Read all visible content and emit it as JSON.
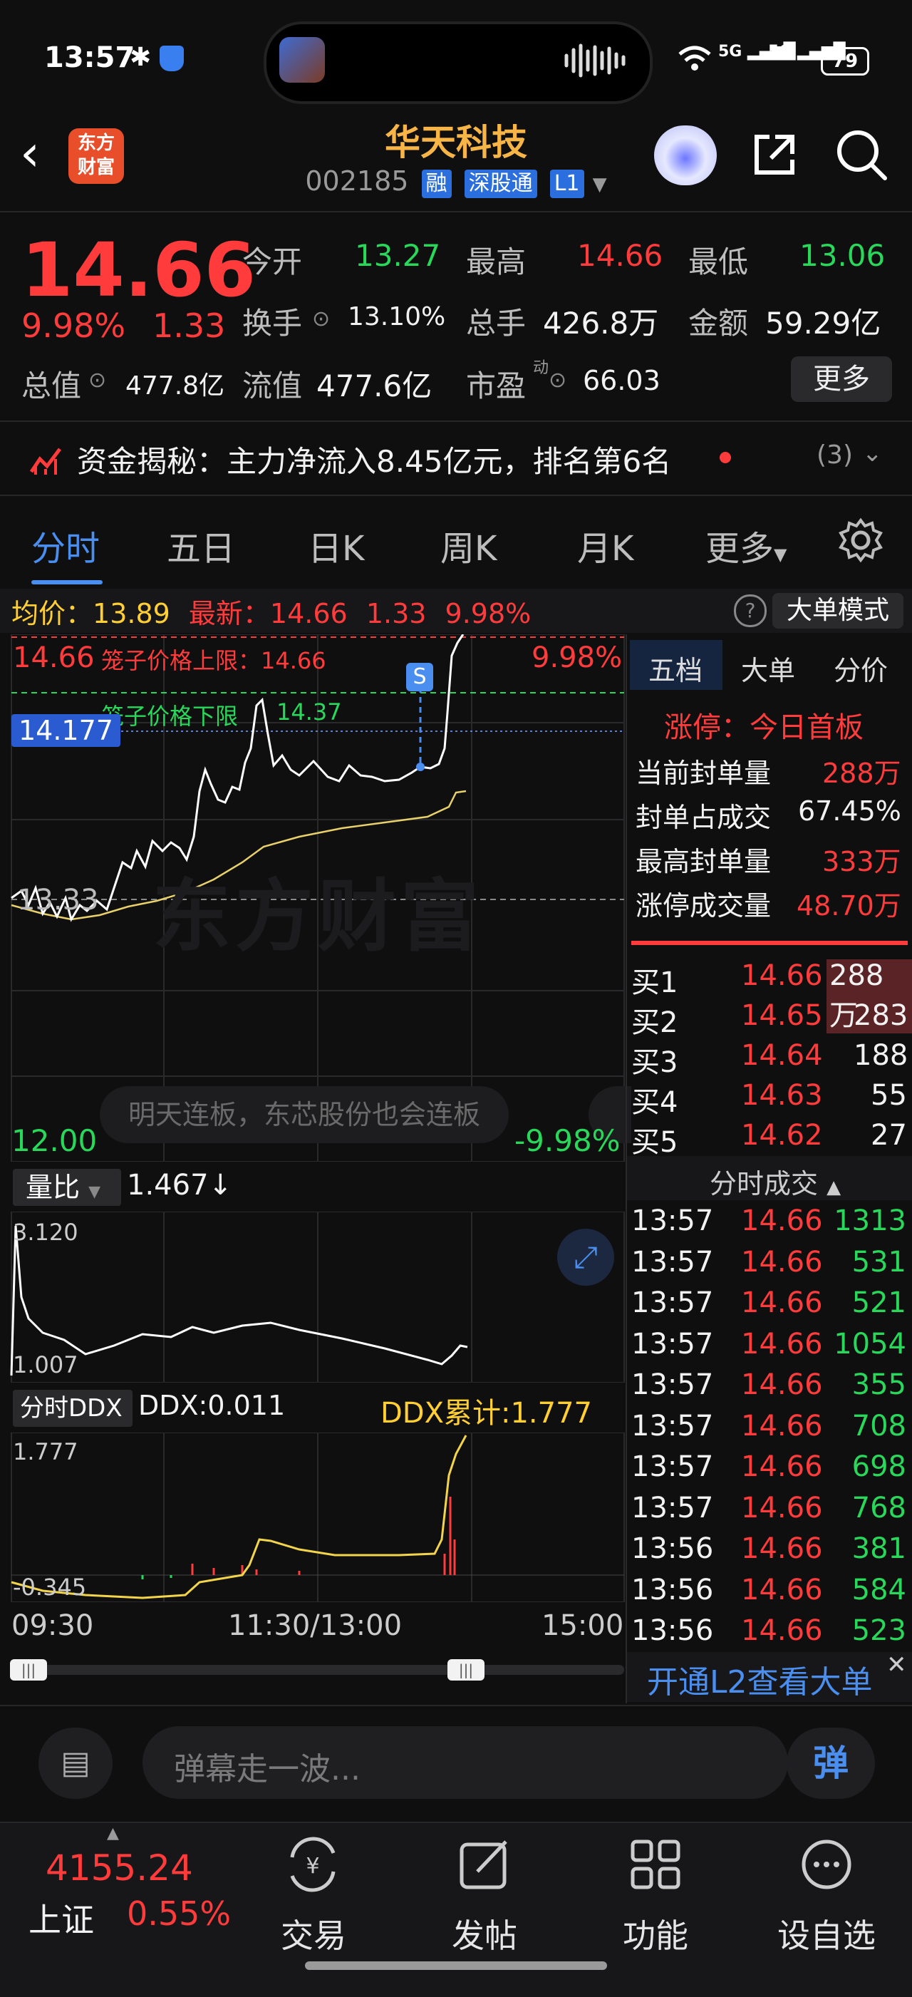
{
  "status_bar": {
    "time": "13:57",
    "battery": "79",
    "net1": "5G",
    "net2": "5G"
  },
  "header": {
    "logo_line1": "东方",
    "logo_line2": "财富",
    "stock_name": "华天科技",
    "code": "002185",
    "tags": [
      "融",
      "深股通",
      "L1"
    ]
  },
  "quote": {
    "price": "14.66",
    "change_pct": "9.98%",
    "change": "1.33",
    "open_label": "今开",
    "open": "13.27",
    "high_label": "最高",
    "high": "14.66",
    "low_label": "最低",
    "low": "13.06",
    "turnover_label": "换手",
    "turnover": "13.10%",
    "volume_label": "总手",
    "volume": "426.8万",
    "amount_label": "金额",
    "amount": "59.29亿",
    "mcap_label": "总值",
    "mcap": "477.8亿",
    "float_label": "流值",
    "float": "477.6亿",
    "pe_label": "市盈",
    "pe_sup": "动",
    "pe": "66.03",
    "more": "更多"
  },
  "funds": {
    "text": "资金揭秘：主力净流入8.45亿元，排名第6名",
    "count": "(3)"
  },
  "tabs": [
    "分时",
    "五日",
    "日K",
    "周K",
    "月K",
    "更多"
  ],
  "chart_header": {
    "avg_label": "均价：",
    "avg": "13.89",
    "latest_label": "最新：",
    "latest": "14.66",
    "latest_chg": "1.33",
    "latest_pct": "9.98%",
    "mode_button": "大单模式"
  },
  "chart": {
    "y_top": "14.66",
    "pct_top": "9.98%",
    "upper_limit_label": "笼子价格上限：14.66",
    "lower_limit_label": "笼子价格下限",
    "lower_limit_val": "14.37",
    "crosshair_price": "14.177",
    "mid_price": "13.33",
    "y_bottom": "12.00",
    "pct_bottom": "-9.98%",
    "marker": "S",
    "watermark": "东方财富",
    "danmu": "明天连板，东芯股份也会连板"
  },
  "ratio_panel": {
    "label": "量比",
    "value": "1.467↓",
    "top": "3.120",
    "bottom": "1.007"
  },
  "ddx_panel": {
    "label": "分时DDX",
    "ddx": "DDX:0.011",
    "ddx_total": "DDX累计:1.777",
    "top": "1.777",
    "bottom": "-0.345"
  },
  "time_axis": [
    "09:30",
    "11:30/13:00",
    "15:00"
  ],
  "right_panel": {
    "tabs": [
      "五档",
      "大单",
      "分价"
    ],
    "limit_title": "涨停：今日首板",
    "stats": [
      {
        "label": "当前封单量",
        "value": "288万"
      },
      {
        "label": "封单占成交",
        "value": "67.45%"
      },
      {
        "label": "最高封单量",
        "value": "333万"
      },
      {
        "label": "涨停成交量",
        "value": "48.70万"
      }
    ],
    "book": [
      {
        "label": "买1",
        "price": "14.66",
        "vol": "288万"
      },
      {
        "label": "买2",
        "price": "14.65",
        "vol": "283"
      },
      {
        "label": "买3",
        "price": "14.64",
        "vol": "188"
      },
      {
        "label": "买4",
        "price": "14.63",
        "vol": "55"
      },
      {
        "label": "买5",
        "price": "14.62",
        "vol": "27"
      }
    ],
    "ticks_title": "分时成交",
    "ticks": [
      {
        "time": "13:57",
        "price": "14.66",
        "vol": "1313"
      },
      {
        "time": "13:57",
        "price": "14.66",
        "vol": "531"
      },
      {
        "time": "13:57",
        "price": "14.66",
        "vol": "521"
      },
      {
        "time": "13:57",
        "price": "14.66",
        "vol": "1054"
      },
      {
        "time": "13:57",
        "price": "14.66",
        "vol": "355"
      },
      {
        "time": "13:57",
        "price": "14.66",
        "vol": "708"
      },
      {
        "time": "13:57",
        "price": "14.66",
        "vol": "698"
      },
      {
        "time": "13:57",
        "price": "14.66",
        "vol": "768"
      },
      {
        "time": "13:56",
        "price": "14.66",
        "vol": "381"
      },
      {
        "time": "13:56",
        "price": "14.66",
        "vol": "584"
      },
      {
        "time": "13:56",
        "price": "14.66",
        "vol": "523"
      }
    ],
    "l2_link": "开通L2查看大单"
  },
  "danmu_input": {
    "placeholder": "弹幕走一波...",
    "send": "弹"
  },
  "bottom_nav": {
    "index_value": "4155.24",
    "index_name": "上证",
    "index_pct": "0.55%",
    "items": [
      "交易",
      "发帖",
      "功能",
      "设自选"
    ]
  }
}
